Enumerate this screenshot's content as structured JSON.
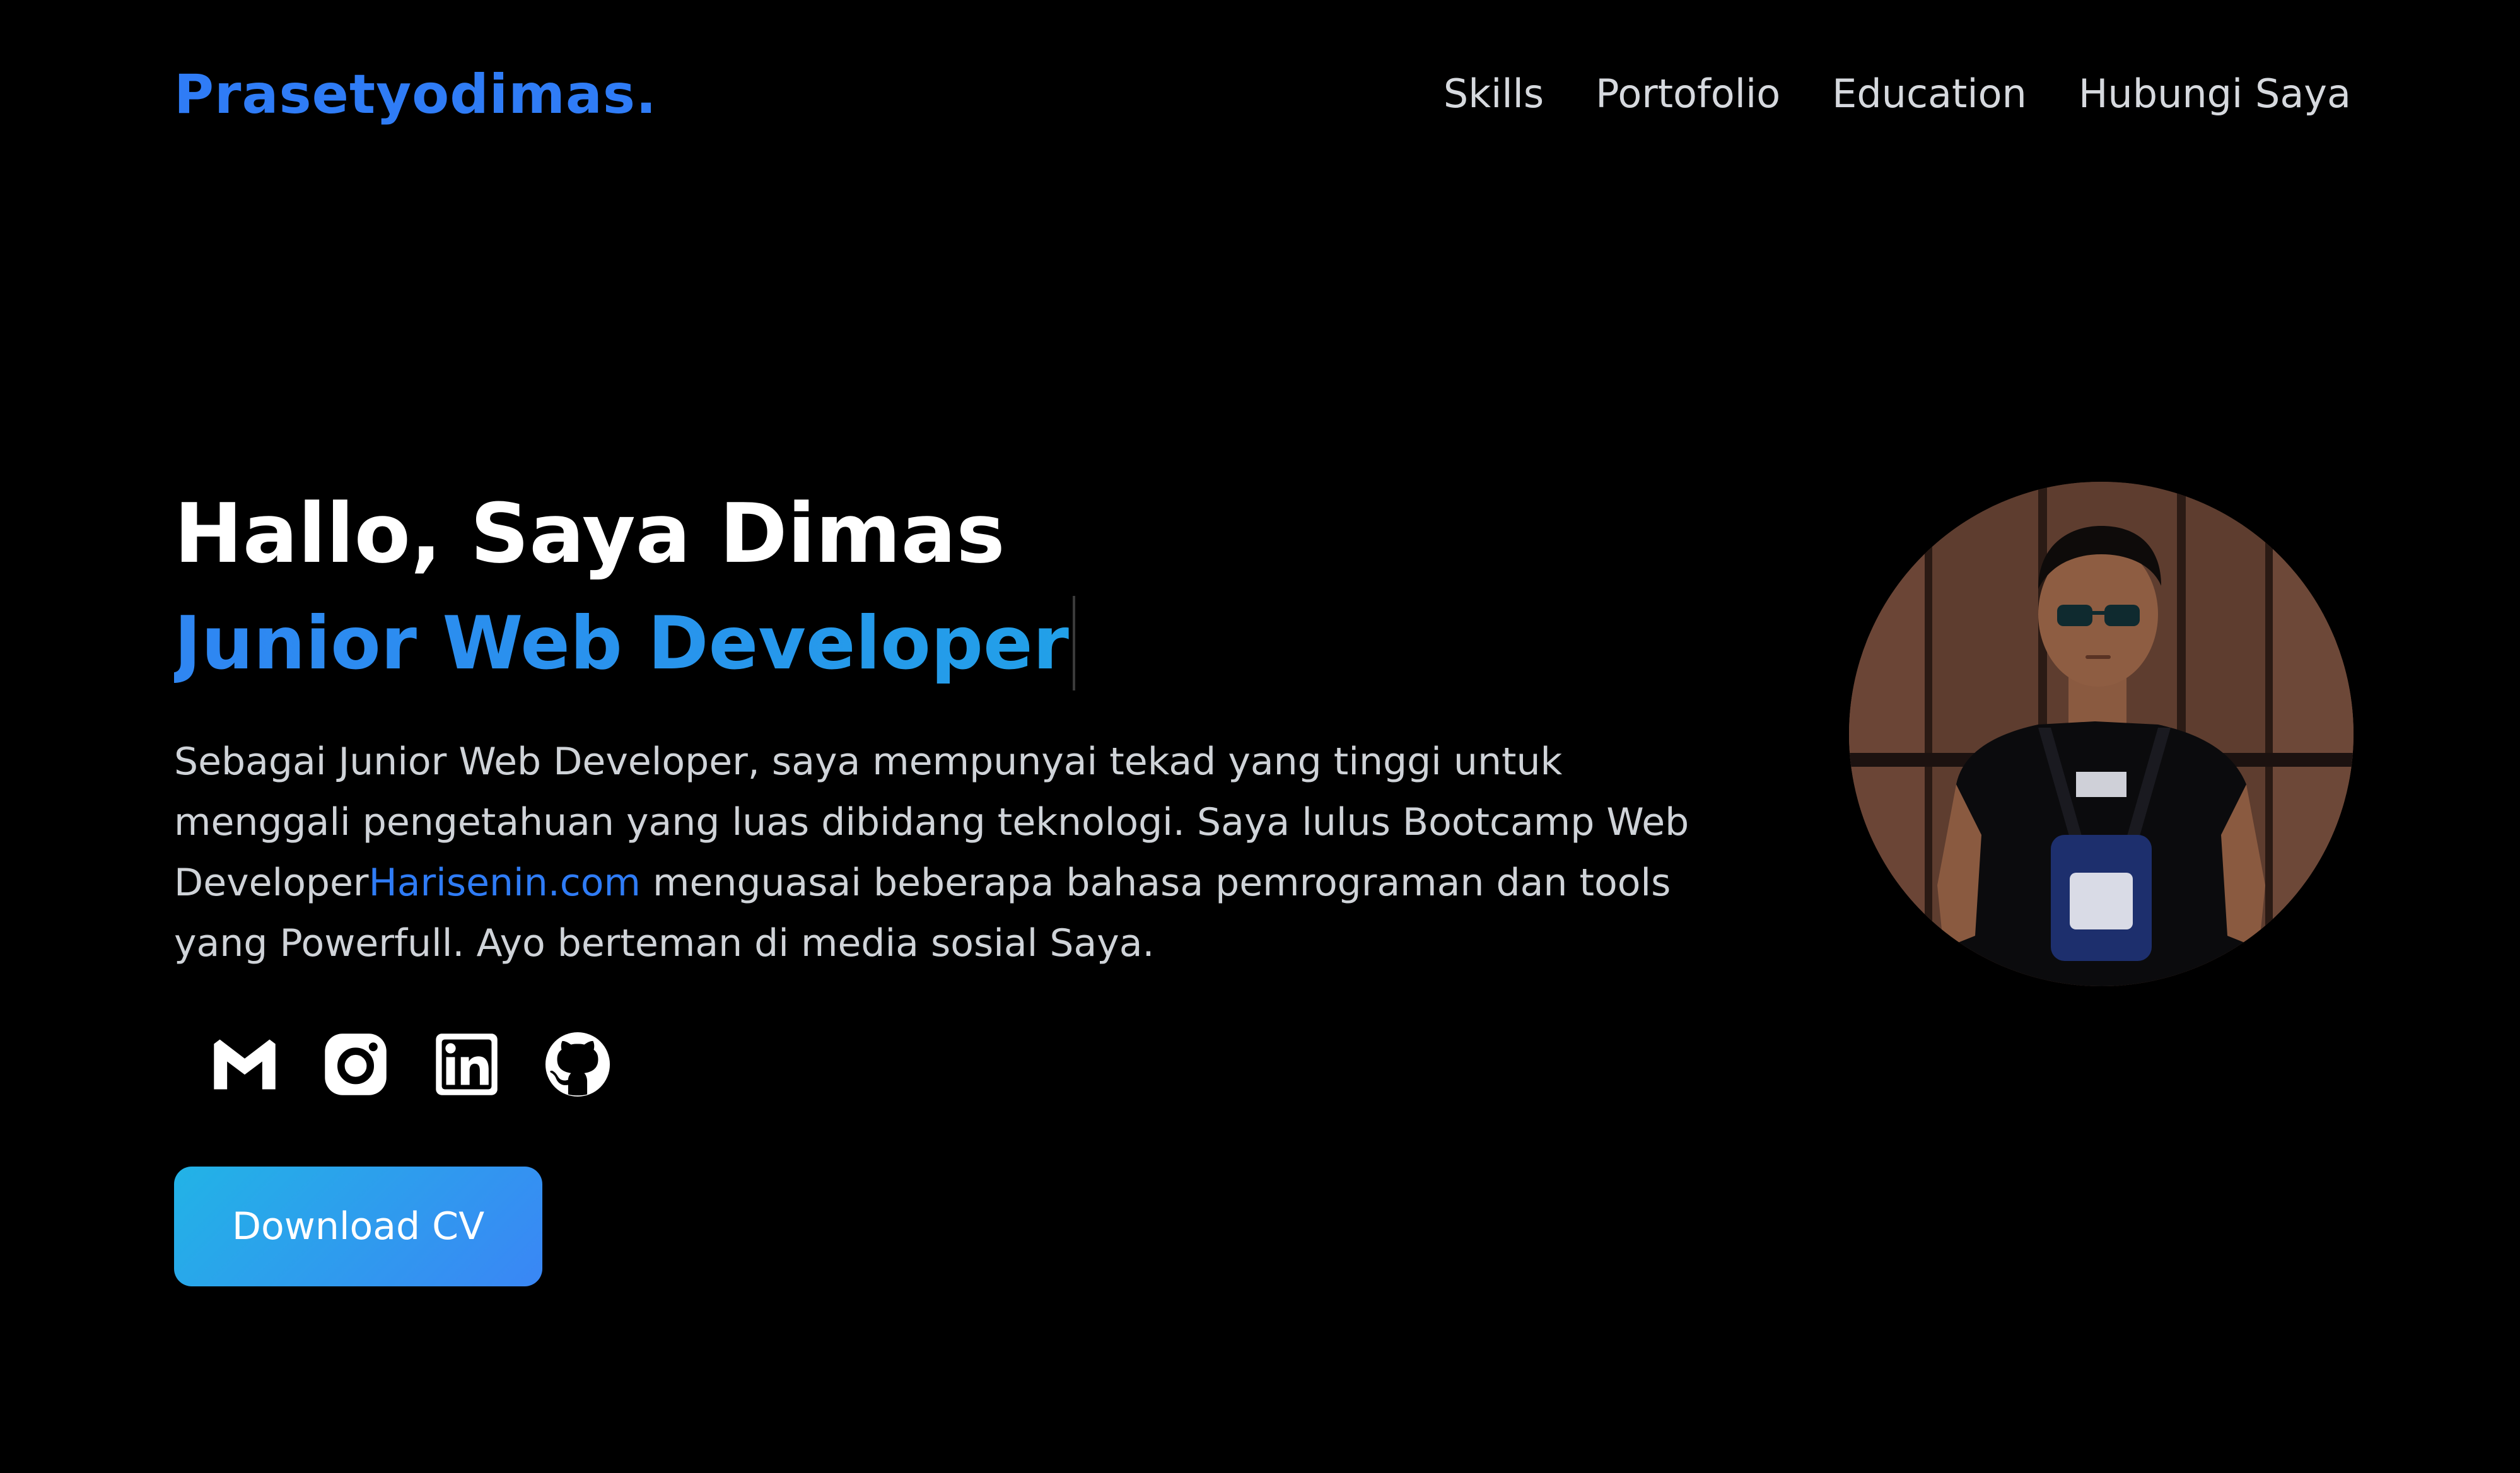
{
  "header": {
    "brand": "Prasetyodimas.",
    "nav": [
      "Skills",
      "Portofolio",
      "Education",
      "Hubungi Saya"
    ]
  },
  "hero": {
    "title": "Hallo, Saya Dimas",
    "subtitle": "Junior Web Developer",
    "desc_part1": "Sebagai Junior Web Developer, saya mempunyai tekad yang tinggi untuk menggali pengetahuan yang luas dibidang teknologi. Saya lulus Bootcamp Web Developer",
    "desc_link": "Harisenin.com",
    "desc_part2": " menguasai beberapa bahasa pemrograman dan tools yang Powerfull. Ayo berteman di media sosial Saya.",
    "social_icons": [
      "gmail-icon",
      "instagram-icon",
      "linkedin-icon",
      "github-icon"
    ],
    "cv_button": "Download CV"
  },
  "colors": {
    "background": "#000000",
    "brand": "#2f7cf6",
    "accent_gradient_start": "#22b3e6",
    "accent_gradient_end": "#3a86f5",
    "link": "#2f7cf6"
  }
}
